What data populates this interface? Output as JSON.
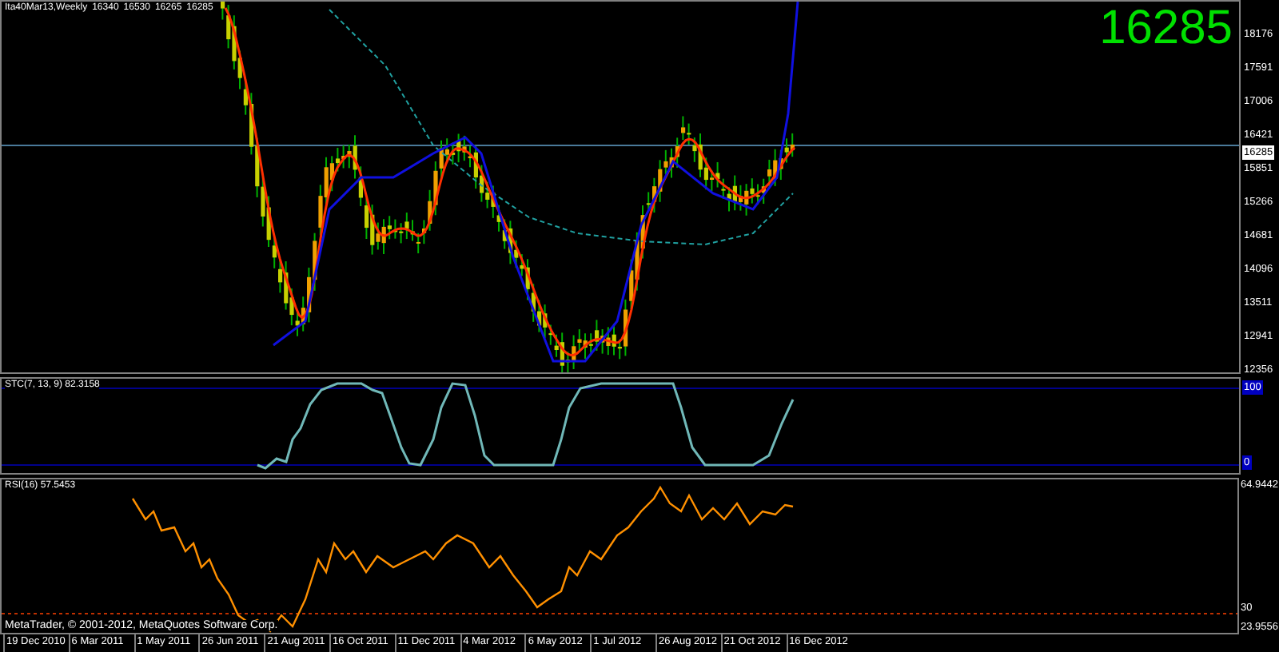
{
  "header": {
    "symbol": "Ita40Mar13,Weekly",
    "ohlc": [
      "16340",
      "16530",
      "16265",
      "16285"
    ]
  },
  "last_price": "16285",
  "price_axis": {
    "labels": [
      "18176",
      "17591",
      "17006",
      "16421",
      "15851",
      "15266",
      "14681",
      "14096",
      "13511",
      "12941",
      "12356"
    ],
    "current": "16285"
  },
  "stc": {
    "title": "STC(7, 13, 9) 82.3158",
    "axis": [
      "100",
      "0"
    ]
  },
  "rsi": {
    "title": "RSI(16) 57.5453",
    "axis": [
      "64.9442",
      "30",
      "23.9556"
    ]
  },
  "copyright": "MetaTrader, © 2001-2012, MetaQuotes Software Corp.",
  "date_axis": [
    "19 Dec 2010",
    "6 Mar 2011",
    "1 May 2011",
    "26 Jun 2011",
    "21 Aug 2011",
    "16 Oct 2011",
    "11 Dec 2011",
    "4 Mar 2012",
    "6 May 2012",
    "1 Jul 2012",
    "26 Aug 2012",
    "21 Oct 2012",
    "16 Dec 2012"
  ]
}
